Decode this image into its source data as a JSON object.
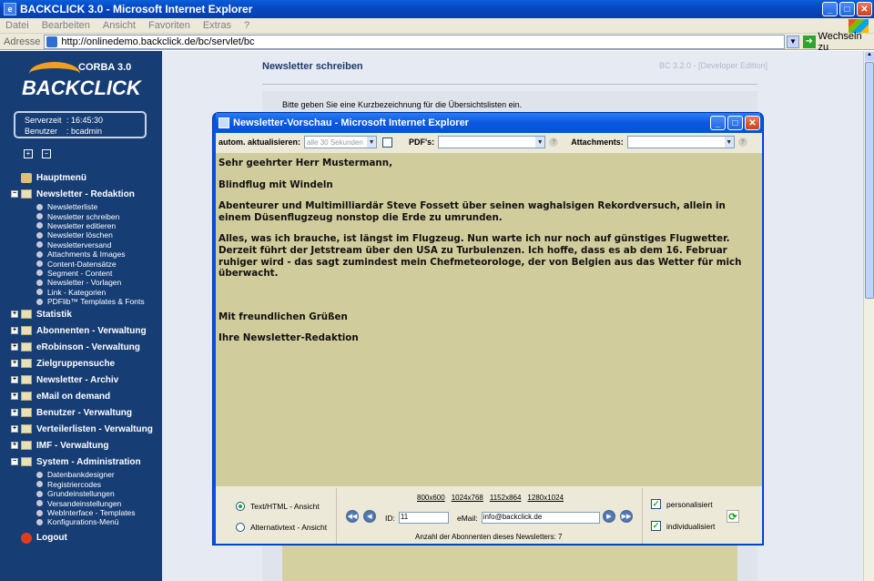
{
  "window": {
    "title": "BACKCLICK 3.0 - Microsoft Internet Explorer"
  },
  "menu": [
    "Datei",
    "Bearbeiten",
    "Ansicht",
    "Favoriten",
    "Extras",
    "?"
  ],
  "address": {
    "label": "Adresse",
    "url": "http://onlinedemo.backclick.de/bc/servlet/bc",
    "go": "Wechseln zu"
  },
  "logo": {
    "corba": "CORBA 3.0",
    "name": "BACKCLICK"
  },
  "server": {
    "time_label": "Serverzeit",
    "time": ": 16:45:30",
    "user_label": "Benutzer",
    "user": ": bcadmin"
  },
  "nav": {
    "home": "Hauptmenü",
    "redaktion": "Newsletter - Redaktion",
    "redaktion_items": [
      "Newsletterliste",
      "Newsletter schreiben",
      "Newsletter editieren",
      "Newsletter löschen",
      "Newsletterversand",
      "Attachments & Images",
      "Content-Datensätze",
      "Segment - Content",
      "Newsletter - Vorlagen",
      "Link - Kategorien",
      "PDFlib™ Templates & Fonts"
    ],
    "groups": [
      "Statistik",
      "Abonnenten - Verwaltung",
      "eRobinson - Verwaltung",
      "Zielgruppensuche",
      "Newsletter - Archiv",
      "eMail on demand",
      "Benutzer - Verwaltung",
      "Verteilerlisten - Verwaltung",
      "IMF - Verwaltung"
    ],
    "system": "System - Administration",
    "system_items": [
      "Datenbankdesigner",
      "Registriercodes",
      "Grundeinstellungen",
      "Versandeinstellungen",
      "WebInterface - Templates",
      "Konfigurations-Menü"
    ],
    "logout": "Logout"
  },
  "main": {
    "title": "Newsletter schreiben",
    "version": "BC 3.2.0 - [Developer Edition]",
    "hint": "Bitte geben Sie eine Kurzbezeichnung für die Übersichtslisten ein."
  },
  "popup": {
    "title": "Newsletter-Vorschau - Microsoft Internet Explorer",
    "auto_label": "autom. aktualisieren:",
    "auto_value": "alle 30 Sekunden",
    "pdf_label": "PDF's:",
    "attach_label": "Attachments:",
    "content": {
      "greeting": "Sehr geehrter Herr Mustermann,",
      "headline": "Blindflug mit Windeln",
      "p1": "Abenteurer und Multimilliardär Steve Fossett über seinen waghalsigen Rekordversuch, allein in einem Düsenflugzeug nonstop die Erde zu umrunden.",
      "p2": "Alles, was ich brauche, ist längst im Flugzeug. Nun warte ich nur noch auf günstiges Flugwetter. Derzeit führt der Jetstream über den USA zu Turbulenzen. Ich hoffe, dass es ab dem 16. Februar ruhiger wird - das sagt zumindest mein Chefmeteorologe, der von Belgien aus das Wetter für mich überwacht.",
      "closing": "Mit freundlichen Grüßen",
      "sign": "Ihre Newsletter-Redaktion"
    },
    "view_html": "Text/HTML - Ansicht",
    "view_alt": "Alternativtext - Ansicht",
    "resolutions": [
      "800x600",
      "1024x768",
      "1152x864",
      "1280x1024"
    ],
    "id_label": "ID:",
    "id_value": "11",
    "email_label": "eMail:",
    "email_value": "info@backclick.de",
    "count": "Anzahl der Abonnenten dieses Newsletters:  7",
    "personalized": "personalisiert",
    "individualized": "individualisiert"
  }
}
